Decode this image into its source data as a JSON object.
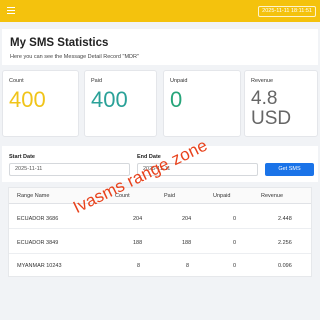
{
  "header": {
    "datetime": "2025-11-11 18:11:51"
  },
  "page": {
    "title": "My SMS Statistics",
    "subtitle": "Here you can see the Message Detail Record \"MDR\""
  },
  "stats": {
    "count_label": "Count",
    "count_value": "400",
    "paid_label": "Paid",
    "paid_value": "400",
    "unpaid_label": "Unpaid",
    "unpaid_value": "0",
    "revenue_label": "Revenue",
    "revenue_value_line1": "4.8",
    "revenue_value_line2": "USD"
  },
  "filter": {
    "start_label": "Start Date",
    "start_value": "2025-11-11",
    "end_label": "End Date",
    "end_value": "2025-11-11",
    "button_label": "Get SMS"
  },
  "table": {
    "headers": [
      "Range Name",
      "Count",
      "Paid",
      "Unpaid",
      "Revenue"
    ],
    "rows": [
      [
        "ECUADOR 3686",
        "204",
        "204",
        "0",
        "2.448"
      ],
      [
        "ECUADOR 3849",
        "188",
        "188",
        "0",
        "2.256"
      ],
      [
        "MYANMAR 10243",
        "8",
        "8",
        "0",
        "0.096"
      ]
    ]
  },
  "watermark": {
    "text": "Ivasms range zone"
  },
  "colors": {
    "topbar": "#f4c20d",
    "count": "#f0c419",
    "paid": "#2aa198",
    "unpaid": "#27a57a",
    "button": "#1a73e8",
    "watermark": "#e8421c"
  }
}
